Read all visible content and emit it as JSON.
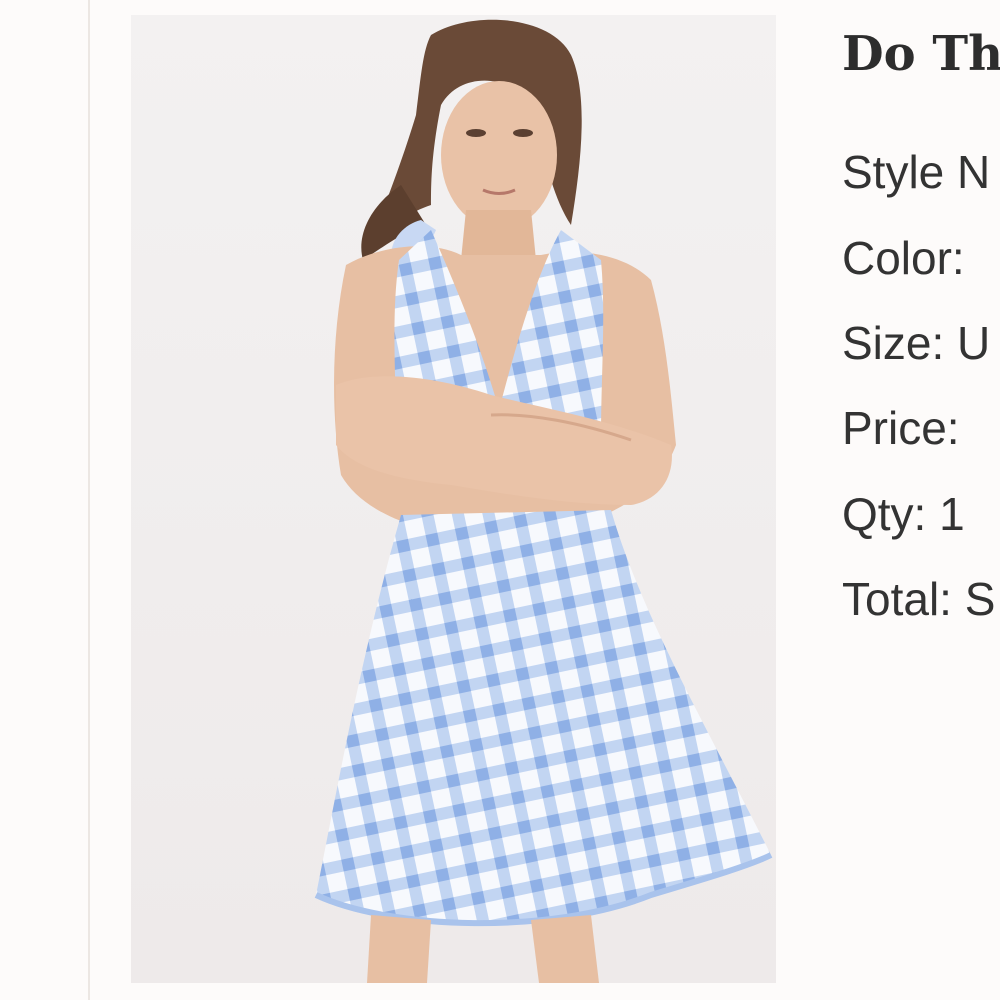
{
  "product": {
    "title": "Do Th",
    "image_alt": "model-wearing-blue-gingham-halter-dress",
    "details": {
      "style": "Style N",
      "color": "Color:",
      "size": "Size: U",
      "price": "Price:",
      "qty": "Qty: 1",
      "total": "Total: S"
    }
  },
  "colors": {
    "background": "#fdfbfa",
    "photo_background": "#f1eeed",
    "gingham_blue": "#9fbde8",
    "text": "#333333"
  }
}
